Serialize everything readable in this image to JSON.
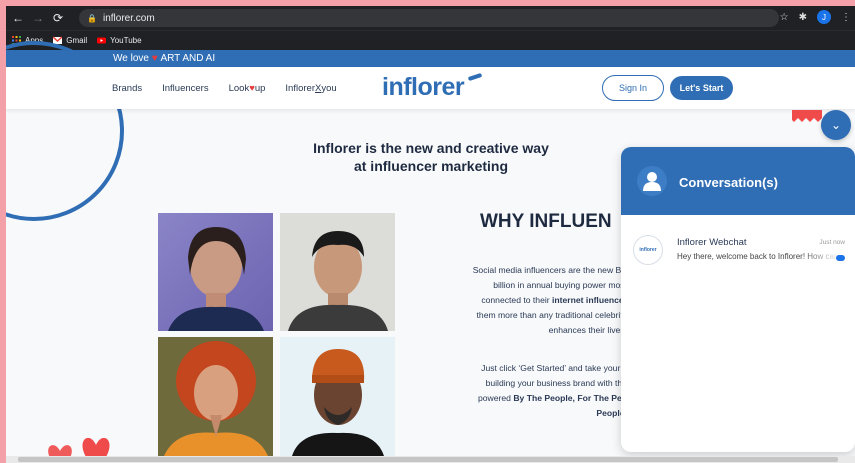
{
  "browser": {
    "url": "inflorer.com",
    "profile_initial": "J",
    "bookmarks": [
      {
        "label": "Apps",
        "icon": "apps-grid-icon"
      },
      {
        "label": "Gmail",
        "icon": "gmail-icon"
      },
      {
        "label": "YouTube",
        "icon": "youtube-icon"
      }
    ]
  },
  "banner": {
    "prefix": "We love",
    "suffix": "ART AND AI"
  },
  "nav": {
    "brands": "Brands",
    "influencers": "Influencers",
    "lookup_prefix": "Look",
    "lookup_suffix": "up",
    "inflorerxyou_prefix": "Inflorer",
    "inflorerxyou_x": "X",
    "inflorerxyou_suffix": "you"
  },
  "header": {
    "logo": "inflorer",
    "signin": "Sign In",
    "start": "Let's Start"
  },
  "hero": {
    "tagline_line1": "Inflorer is the new and creative way",
    "tagline_line2": "at influencer marketing"
  },
  "why": {
    "title": "WHY INFLUEN",
    "p1_l1": "Social media influencers are the new Bill",
    "p1_l2": "billion in annual buying power most",
    "p1_l3_pre": "connected to their",
    "p1_l3_bold": "internet influencer",
    "p1_l4": "them more than any traditional celebrity",
    "p1_l5": "enhances their lives.",
    "p2_l1": "Just click ‘Get Started’ and take your fi",
    "p2_l2": "building your business brand with the",
    "p2_l3_pre": "powered",
    "p2_l3_bold": "By The People, For The Peo",
    "p2_l4_bold": "People."
  },
  "chat": {
    "title": "Conversation(s)",
    "conversation": {
      "logo_text": "inflorer",
      "name": "Inflorer Webchat",
      "time": "Just now",
      "message": "Hey there, welcome back to Inflorer! How can we help"
    }
  },
  "colors": {
    "brand": "#2f6db4",
    "accent": "#e53b3b",
    "page_border": "#f4a0a8"
  }
}
